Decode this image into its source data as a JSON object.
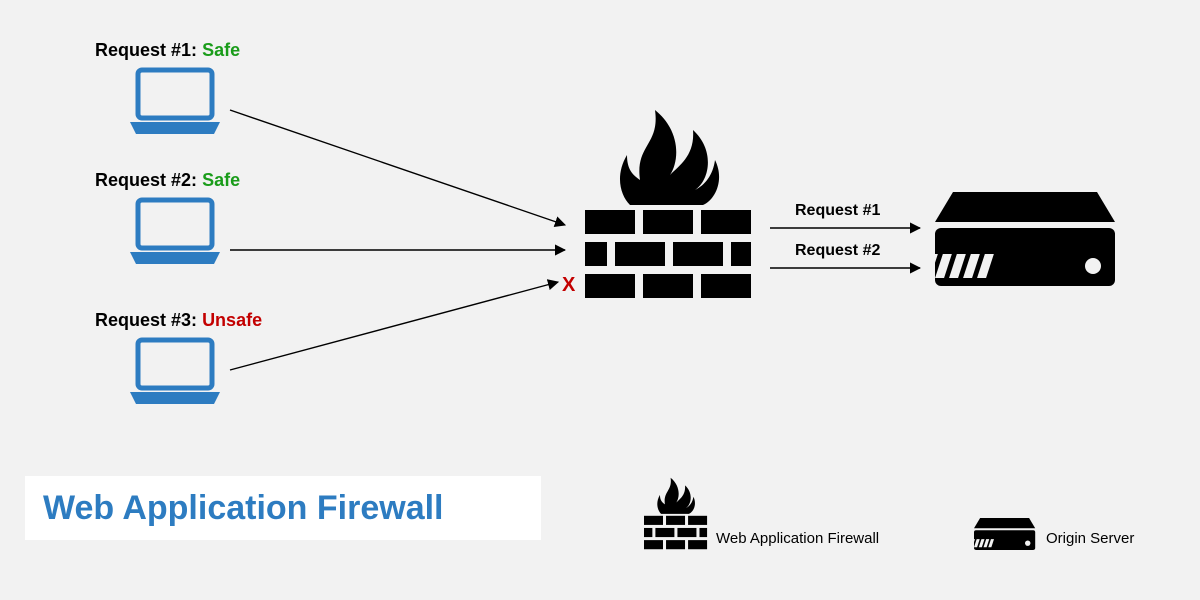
{
  "title": "Web Application Firewall",
  "requests": [
    {
      "prefix": "Request #1:",
      "status": "Safe",
      "status_class": "safe"
    },
    {
      "prefix": "Request #2:",
      "status": "Safe",
      "status_class": "safe"
    },
    {
      "prefix": "Request #3:",
      "status": "Unsafe",
      "status_class": "unsafe"
    }
  ],
  "passed": [
    "Request #1",
    "Request #2"
  ],
  "block_mark": "X",
  "legend": {
    "waf": "Web Application Firewall",
    "server": "Origin Server"
  },
  "colors": {
    "laptop": "#2d7cc1",
    "safe": "#1a9c1a",
    "unsafe": "#c30000",
    "black": "#000000"
  }
}
